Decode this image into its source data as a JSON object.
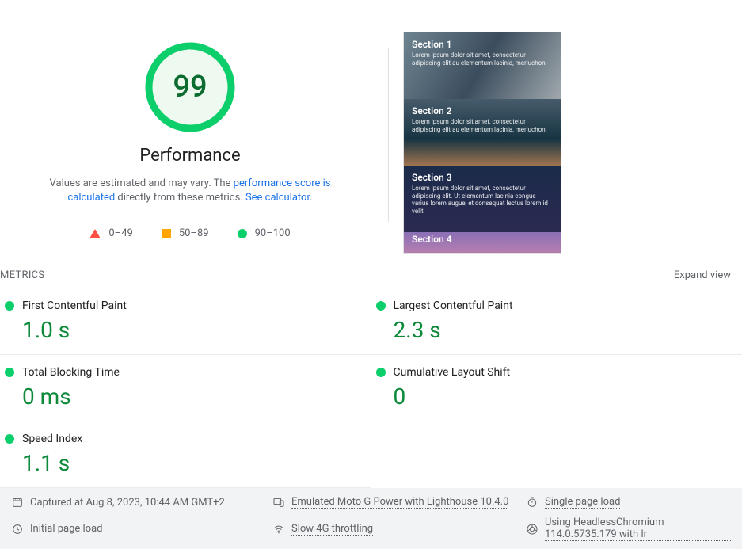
{
  "gauge": {
    "score": "99",
    "percent": 99
  },
  "title": "Performance",
  "desc_pre": "Values are estimated and may vary. The ",
  "desc_link1": "performance score is calculated",
  "desc_mid": " directly from these metrics. ",
  "desc_link2": "See calculator",
  "legend": {
    "fail": "0–49",
    "avg": "50–89",
    "pass": "90–100"
  },
  "preview": {
    "sections": [
      {
        "title": "Section 1",
        "body": "Lorem ipsum dolor sit amet, consectetur adipiscing elit au elementum lacinia, merluchon."
      },
      {
        "title": "Section 2",
        "body": "Lorem ipsum dolor sit amet, consectetur adipiscing elit au elementum lacinia, merluchon."
      },
      {
        "title": "Section 3",
        "body": "Lorem ipsum dolor sit amet, consectetur adipiscing elit. Ut elementum lacinia congue varius lorem augue, et consequat lectus lorem id velit."
      },
      {
        "title": "Section 4",
        "body": ""
      }
    ]
  },
  "metrics_label": "METRICS",
  "expand": "Expand view",
  "metrics": [
    {
      "name": "First Contentful Paint",
      "value": "1.0 s"
    },
    {
      "name": "Largest Contentful Paint",
      "value": "2.3 s"
    },
    {
      "name": "Total Blocking Time",
      "value": "0 ms"
    },
    {
      "name": "Cumulative Layout Shift",
      "value": "0"
    },
    {
      "name": "Speed Index",
      "value": "1.1 s"
    }
  ],
  "footer": {
    "captured": "Captured at Aug 8, 2023, 10:44 AM GMT+2",
    "emulated": "Emulated Moto G Power with Lighthouse 10.4.0",
    "single": "Single page load",
    "initial": "Initial page load",
    "throttling": "Slow 4G throttling",
    "browser": "Using HeadlessChromium 114.0.5735.179 with lr"
  }
}
